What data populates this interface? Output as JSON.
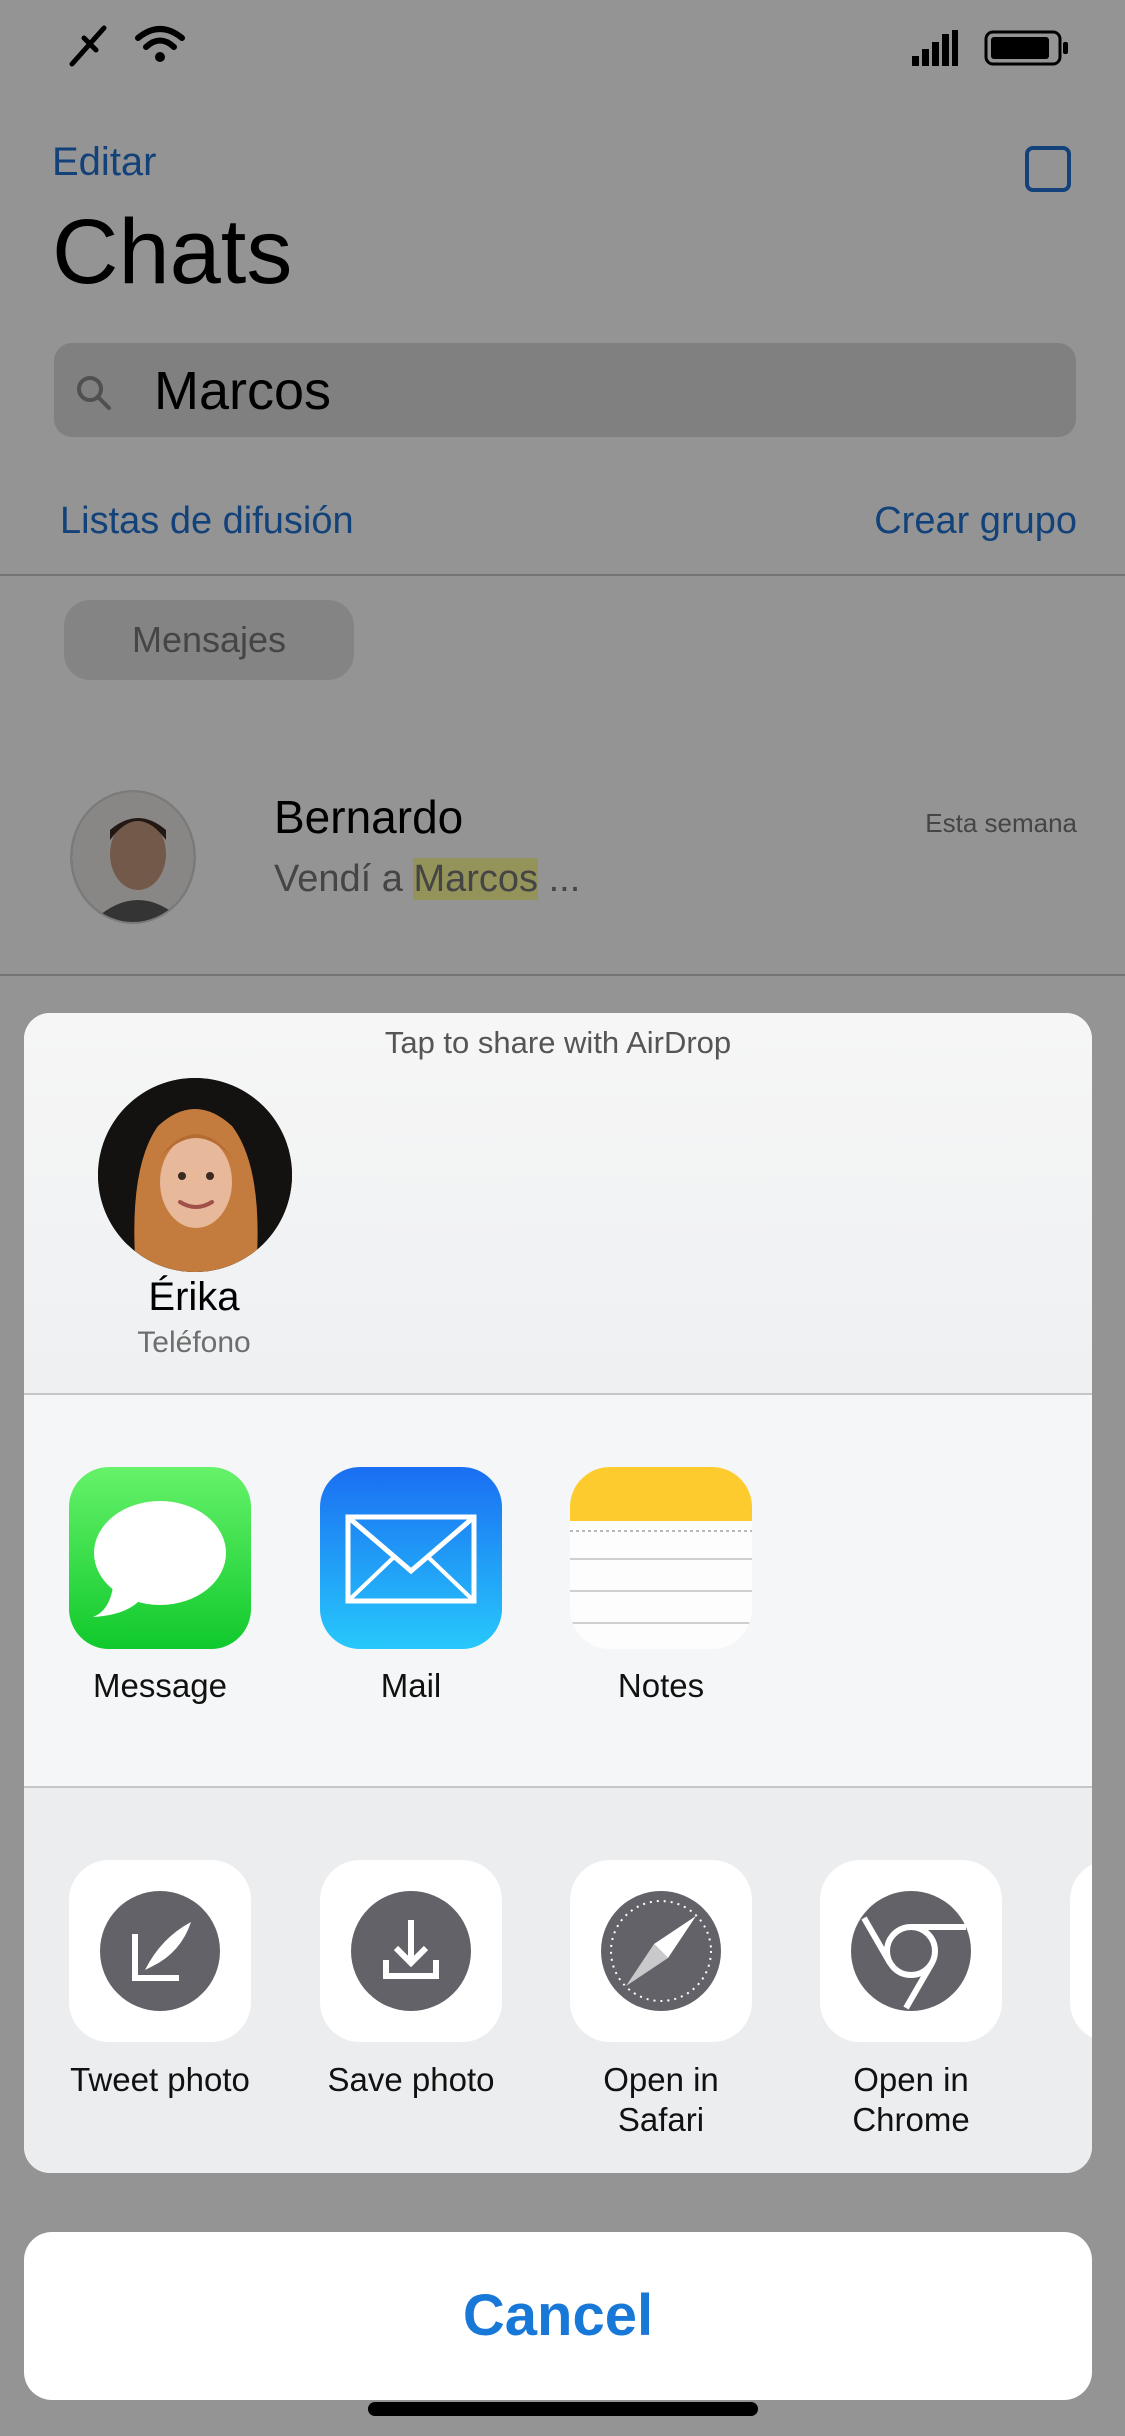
{
  "status_bar": {
    "icons": [
      "tool-icon",
      "wifi-icon",
      "signal-icon",
      "battery-icon"
    ]
  },
  "header": {
    "edit": "Editar",
    "title": "Chats",
    "compose_icon": "compose-icon"
  },
  "search": {
    "value": "Marcos"
  },
  "links": {
    "broadcast": "Listas de difusión",
    "new_group": "Crear grupo"
  },
  "filter_chip": "Mensajes",
  "chats": [
    {
      "name": "Bernardo",
      "time": "Esta semana",
      "preview_before": "Vendí a ",
      "preview_match": "Marcos",
      "preview_after": " ..."
    }
  ],
  "share_sheet": {
    "airdrop_hint": "Tap to share with AirDrop",
    "contact": {
      "name": "Érika",
      "device": "Teléfono"
    },
    "apps": [
      {
        "label": "Message",
        "icon": "messages-icon"
      },
      {
        "label": "Mail",
        "icon": "mail-icon"
      },
      {
        "label": "Notes",
        "icon": "notes-icon"
      }
    ],
    "actions": [
      {
        "label": "Tweet photo",
        "icon": "tweet-icon"
      },
      {
        "label": "Save photo",
        "icon": "download-icon"
      },
      {
        "label": "Open in Safari",
        "icon": "safari-icon"
      },
      {
        "label": "Open in Chrome",
        "icon": "chrome-icon"
      }
    ],
    "cancel": "Cancel"
  },
  "colors": {
    "accent": "#1878d8",
    "link": "#1f73d1",
    "highlight": "#ffff9c"
  }
}
